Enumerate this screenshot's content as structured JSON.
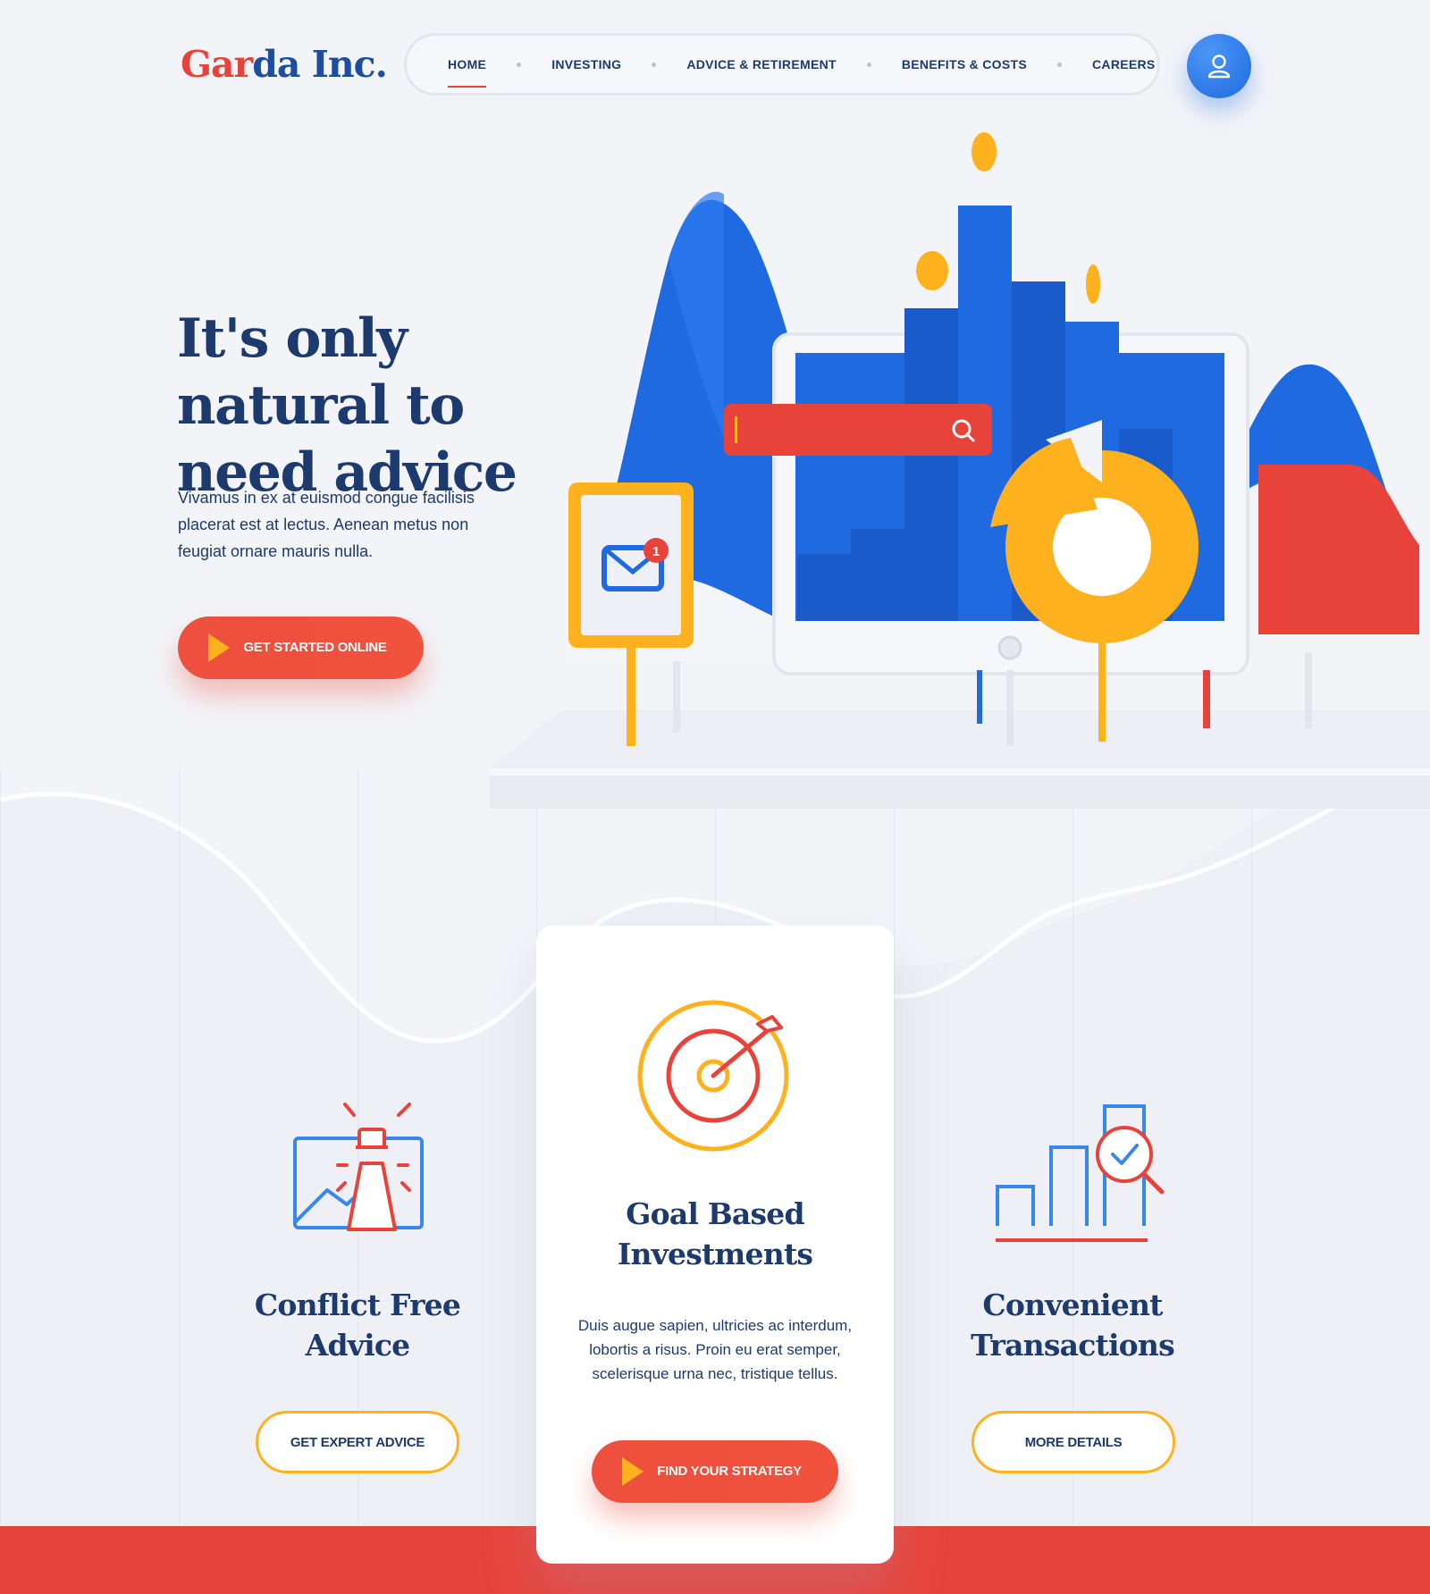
{
  "brand": {
    "logo_part1": "Gar",
    "logo_part2": "da Inc."
  },
  "nav": {
    "items": [
      {
        "label": "HOME",
        "active": true
      },
      {
        "label": "INVESTING",
        "active": false
      },
      {
        "label": "ADVICE & RETIREMENT",
        "active": false
      },
      {
        "label": "BENEFITS & COSTS",
        "active": false
      },
      {
        "label": "CAREERS",
        "active": false
      }
    ],
    "user_icon": "user-icon"
  },
  "hero": {
    "title": "It's only natural to need advice",
    "text": "Vivamus in ex at euismod congue facilisis placerat est at lectus. Aenean metus non feugiat ornare mauris nulla.",
    "cta_label": "GET STARTED ONLINE",
    "mail_badge": "1"
  },
  "features": [
    {
      "title": "Conflict Free Advice",
      "icon": "lighthouse-chart-icon",
      "button_label": "GET EXPERT ADVICE"
    },
    {
      "title": "Goal Based Investments",
      "icon": "target-arrow-icon",
      "text": "Duis augue sapien, ultricies ac interdum, lobortis a risus. Proin eu erat semper, scelerisque urna nec, tristique tellus.",
      "button_label": "FIND YOUR STRATEGY"
    },
    {
      "title": "Convenient Transactions",
      "icon": "bar-chart-magnifier-icon",
      "button_label": "MORE DETAILS"
    }
  ],
  "colors": {
    "navy": "#1d3a6e",
    "blue": "#1f6ae0",
    "red": "#e8433b",
    "orange": "#ffb21e",
    "background": "#f3f4f8"
  }
}
